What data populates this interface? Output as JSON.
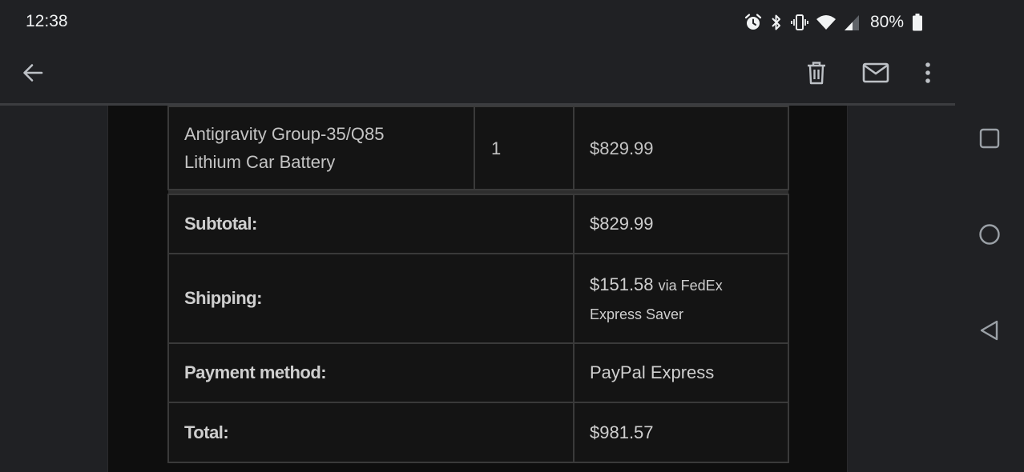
{
  "status_bar": {
    "time": "12:38",
    "battery_percent": "80%",
    "icons": [
      "alarm-icon",
      "bluetooth-icon",
      "vibrate-icon",
      "wifi-icon",
      "cellular-signal-icon",
      "battery-icon"
    ]
  },
  "app_bar": {
    "back_icon": "arrow-back-icon",
    "actions": [
      "delete-icon",
      "mark-unread-icon",
      "more-options-icon"
    ]
  },
  "order": {
    "item": {
      "name_line1": "Antigravity Group-35/Q85",
      "name_line2": "Lithium Car Battery",
      "quantity": "1",
      "price": "$829.99"
    },
    "subtotal": {
      "label": "Subtotal:",
      "value": "$829.99"
    },
    "shipping": {
      "label": "Shipping:",
      "amount": "$151.58",
      "method_line1": "via FedEx",
      "method_line2": "Express Saver"
    },
    "payment_method": {
      "label": "Payment method:",
      "value": "PayPal Express"
    },
    "total": {
      "label": "Total:",
      "value": "$981.57"
    }
  },
  "nav_bar": {
    "buttons": [
      "recents-square-icon",
      "home-circle-icon",
      "back-triangle-icon"
    ]
  },
  "colors": {
    "background": "#202124",
    "email_background": "#0e0e0e",
    "table_cell": "#141414",
    "table_border": "#3a3a3a",
    "text": "#e8eaed"
  }
}
